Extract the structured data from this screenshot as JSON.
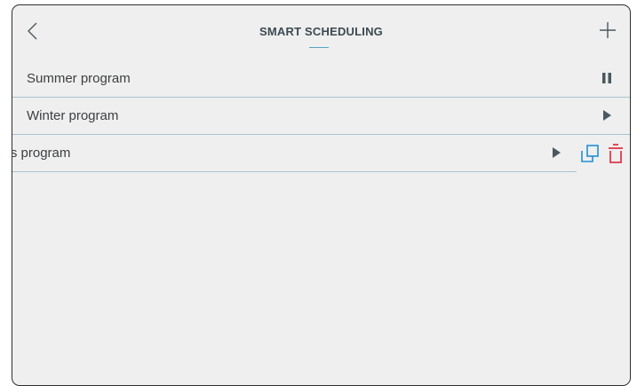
{
  "header": {
    "title": "SMART SCHEDULING",
    "back_icon": "chevron-left-icon",
    "add_icon": "plus-icon"
  },
  "programs": [
    {
      "name": "Summer program",
      "state": "running",
      "action_icon": "pause-icon"
    },
    {
      "name": "Winter program",
      "state": "stopped",
      "action_icon": "play-icon"
    },
    {
      "name": "ays program",
      "state": "stopped",
      "action_icon": "play-icon",
      "swiped": true
    }
  ],
  "swipe_actions": {
    "copy_icon": "copy-icon",
    "delete_icon": "trash-icon"
  },
  "colors": {
    "background": "#efefef",
    "text": "#3b3f42",
    "title": "#3c4a52",
    "accent": "#1f8fd6",
    "divider": "#a9c3d2",
    "icon": "#4a5860",
    "delete": "#e0384a"
  }
}
